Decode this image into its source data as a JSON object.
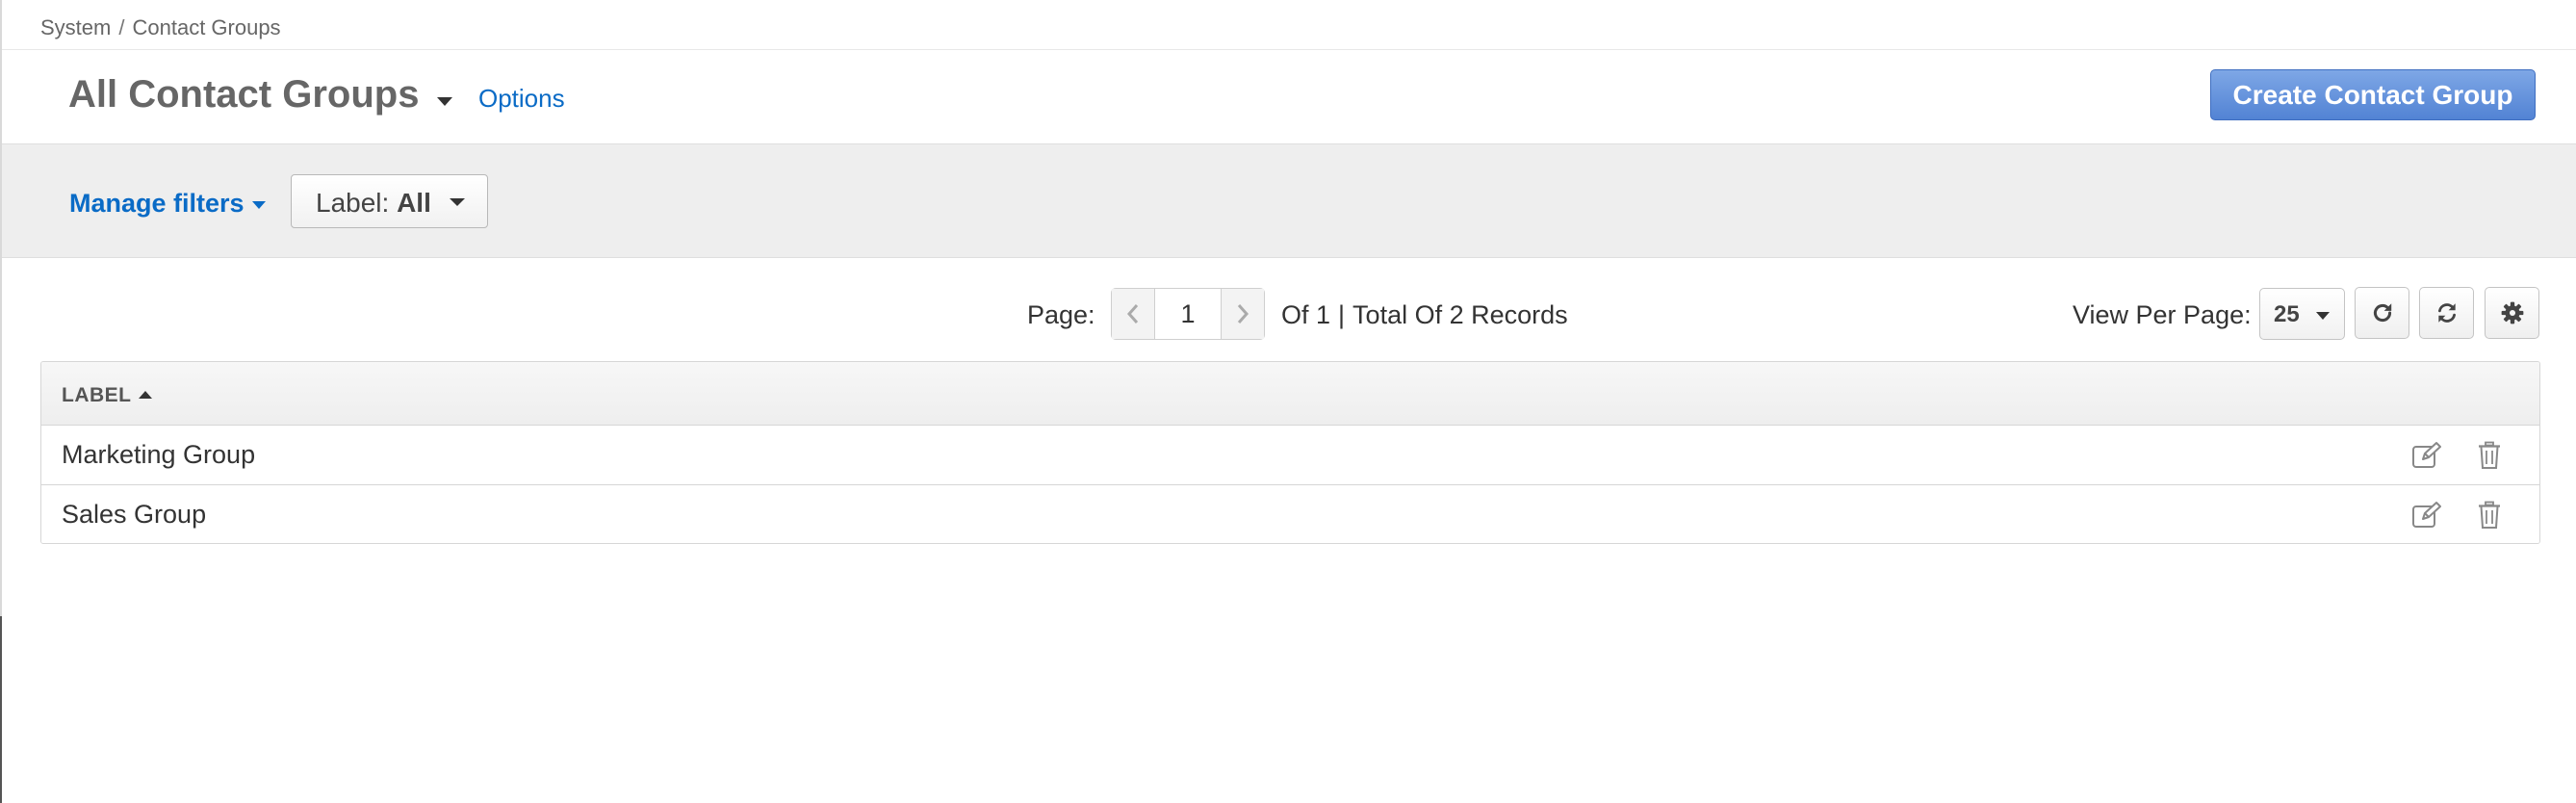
{
  "breadcrumb": {
    "items": [
      "System",
      "Contact Groups"
    ],
    "separator": "/"
  },
  "header": {
    "title": "All Contact Groups",
    "options_label": "Options",
    "create_button_label": "Create Contact Group"
  },
  "filters": {
    "manage_label": "Manage filters",
    "label_filter": {
      "name": "Label:",
      "value": "All"
    }
  },
  "pagination": {
    "page_label": "Page:",
    "current_page": "1",
    "of_text": "Of 1",
    "divider": "|",
    "total_text": "Total Of 2 Records",
    "view_per_page_label": "View Per Page:",
    "per_page_value": "25"
  },
  "table": {
    "columns": [
      {
        "label": "LABEL",
        "sort": "ascending"
      }
    ],
    "rows": [
      {
        "label": "Marketing Group"
      },
      {
        "label": "Sales Group"
      }
    ]
  },
  "icons": {
    "prev": "chevron-left-icon",
    "next": "chevron-right-icon",
    "refresh": "refresh-icon",
    "reset": "sync-icon",
    "settings": "gear-icon",
    "edit": "edit-icon",
    "delete": "trash-icon"
  },
  "colors": {
    "link": "#0a6bc6",
    "primary_button": "#5b8bd8",
    "filter_bar_bg": "#eeeeee"
  }
}
